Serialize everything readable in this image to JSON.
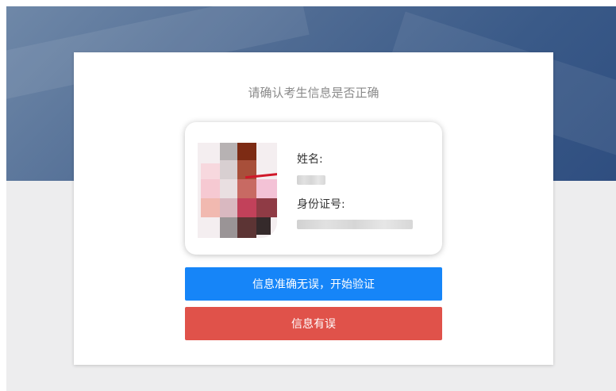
{
  "dialog": {
    "title": "请确认考生信息是否正确"
  },
  "card": {
    "name_label": "姓名:",
    "id_label": "身份证号:"
  },
  "buttons": {
    "confirm_label": "信息准确无误，开始验证",
    "error_label": "信息有误"
  },
  "colors": {
    "confirm": "#1685f8",
    "error": "#e0524a",
    "title_text": "#8a8a8a"
  }
}
